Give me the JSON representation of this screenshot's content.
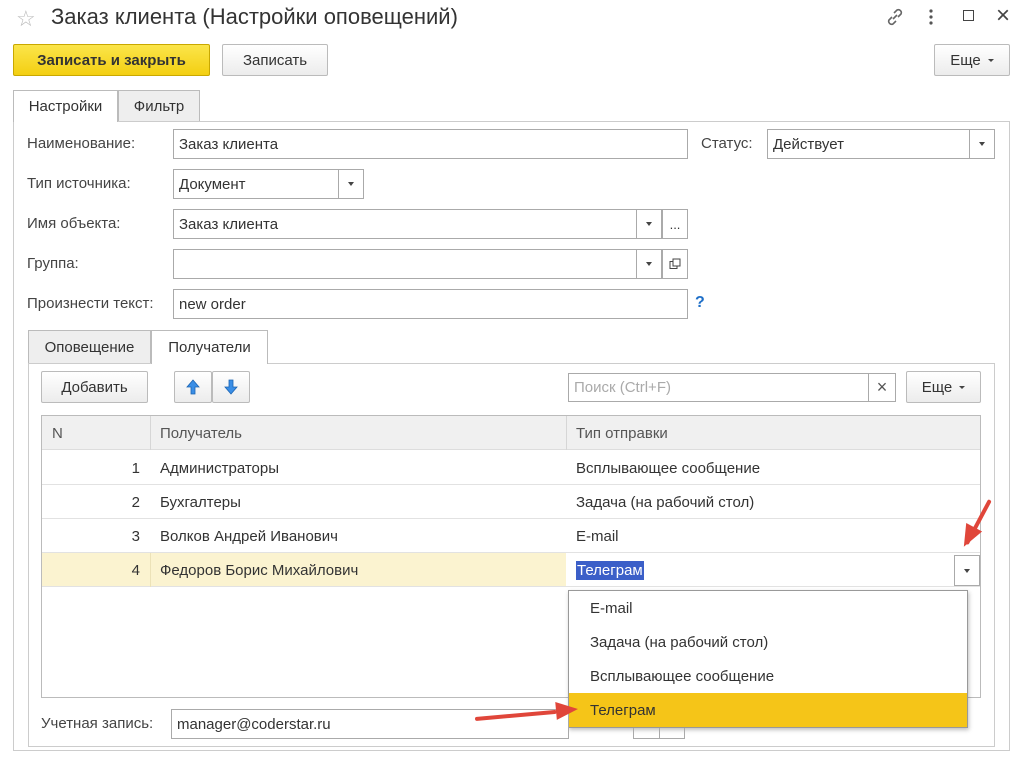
{
  "window": {
    "title": "Заказ клиента (Настройки оповещений)"
  },
  "toolbar": {
    "save_close_label": "Записать и закрыть",
    "save_label": "Записать",
    "more_label": "Еще"
  },
  "tabs": [
    {
      "label": "Настройки",
      "active": true
    },
    {
      "label": "Фильтр",
      "active": false
    }
  ],
  "form": {
    "name_label": "Наименование:",
    "name_value": "Заказ клиента",
    "status_label": "Статус:",
    "status_value": "Действует",
    "source_type_label": "Тип источника:",
    "source_type_value": "Документ",
    "object_name_label": "Имя объекта:",
    "object_name_value": "Заказ клиента",
    "object_name_more": "...",
    "group_label": "Группа:",
    "group_value": "",
    "speak_text_label": "Произнести текст:",
    "speak_text_value": "new order",
    "help_mark": "?"
  },
  "subtabs": [
    {
      "label": "Оповещение",
      "active": false
    },
    {
      "label": "Получатели",
      "active": true
    }
  ],
  "recipients_toolbar": {
    "add_label": "Добавить",
    "search_placeholder": "Поиск (Ctrl+F)",
    "clear_icon": "×",
    "more_label": "Еще"
  },
  "table": {
    "columns": [
      "N",
      "Получатель",
      "Тип отправки"
    ],
    "rows": [
      {
        "n": "1",
        "recipient": "Администраторы",
        "send_type": "Всплывающее сообщение"
      },
      {
        "n": "2",
        "recipient": "Бухгалтеры",
        "send_type": "Задача (на рабочий стол)"
      },
      {
        "n": "3",
        "recipient": "Волков Андрей Иванович",
        "send_type": "E-mail"
      },
      {
        "n": "4",
        "recipient": "Федоров Борис Михайлович",
        "send_type": "Телеграм"
      }
    ],
    "selected_row": 4
  },
  "dropdown": {
    "options": [
      "E-mail",
      "Задача (на рабочий стол)",
      "Всплывающее сообщение",
      "Телеграм"
    ],
    "highlighted": "Телеграм"
  },
  "account": {
    "label": "Учетная запись:",
    "value": "manager@coderstar.ru"
  },
  "colors": {
    "accent_yellow": "#f5d31e",
    "highlight_yellow": "#f5c518",
    "selected_row": "#fbf3d0",
    "arrow_red": "#e0463a",
    "selection_blue": "#3b5fc8"
  },
  "icons": {
    "star": "star-icon",
    "link": "link-icon",
    "more": "more-vertical-icon",
    "maximize": "maximize-icon",
    "close": "close-icon",
    "up": "arrow-up-icon",
    "down": "arrow-down-icon"
  }
}
